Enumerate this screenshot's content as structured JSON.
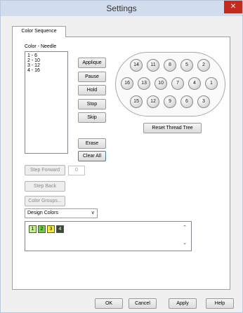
{
  "window": {
    "title": "Settings",
    "close": "✕"
  },
  "tabs": [
    {
      "label": "Color Sequence"
    }
  ],
  "color_needle": {
    "label": "Color - Needle",
    "items": [
      "1 - 6",
      "2 - 10",
      "3 - 12",
      "4 - 16"
    ]
  },
  "buttons": {
    "applique": "Applique",
    "pause": "Pause",
    "hold": "Hold",
    "stop": "Stop",
    "skip": "Skip",
    "erase": "Erase",
    "clear_all": "Clear All",
    "reset_thread_tree": "Reset Thread Tree",
    "step_forward": "Step Forward",
    "step_back": "Step Back",
    "color_groups": "Color Groups..."
  },
  "step_value": "0",
  "thread_tree": {
    "row1": [
      "14",
      "11",
      "8",
      "5",
      "2"
    ],
    "row2": [
      "16",
      "13",
      "10",
      "7",
      "4",
      "1"
    ],
    "row3": [
      "15",
      "12",
      "9",
      "6",
      "3"
    ]
  },
  "design_colors": {
    "selected": "Design Colors",
    "swatches": [
      {
        "label": "1",
        "color": "#c8ec8e"
      },
      {
        "label": "2",
        "color": "#6fcf3f"
      },
      {
        "label": "3",
        "color": "#f3ea3c"
      },
      {
        "label": "4",
        "color": "#3a4a2e"
      }
    ]
  },
  "footer": {
    "ok": "OK",
    "cancel": "Cancel",
    "apply": "Apply",
    "help": "Help"
  },
  "icons": {
    "close": "close-icon",
    "combo": "chevron-down-icon",
    "up": "scroll-up-icon",
    "down": "scroll-down-icon"
  }
}
